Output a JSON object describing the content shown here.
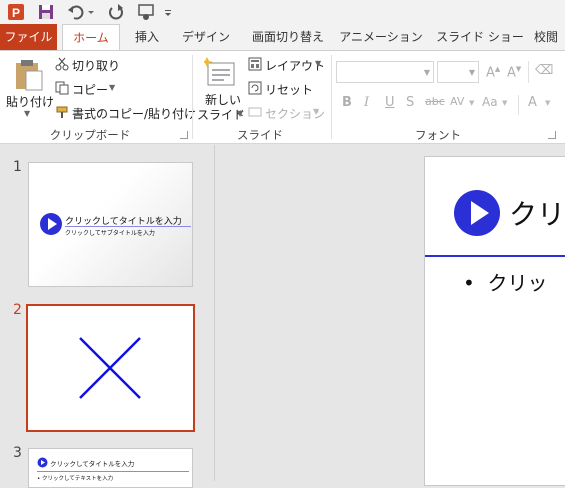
{
  "qat": {
    "icons": [
      "powerpoint-app-icon",
      "save-icon",
      "undo-icon",
      "redo-icon",
      "start-from-beginning-icon",
      "customize-qat-icon"
    ]
  },
  "tabs": [
    {
      "label": "ファイル"
    },
    {
      "label": "ホーム"
    },
    {
      "label": "挿入"
    },
    {
      "label": "デザイン"
    },
    {
      "label": "画面切り替え"
    },
    {
      "label": "アニメーション"
    },
    {
      "label": "スライド ショー"
    },
    {
      "label": "校閲"
    }
  ],
  "clipboard": {
    "paste_label": "貼り付け",
    "cut_label": "切り取り",
    "copy_label": "コピー",
    "format_painter_label": "書式のコピー/貼り付け",
    "group_label": "クリップボード"
  },
  "slides_group": {
    "new_slide_line1": "新しい",
    "new_slide_line2": "スライド",
    "layout_label": "レイアウト",
    "reset_label": "リセット",
    "section_label": "セクション",
    "group_label": "スライド"
  },
  "font_group": {
    "group_label": "フォント",
    "font_name": "",
    "font_size": ""
  },
  "thumbnails": [
    {
      "number": "1",
      "title": "クリックしてタイトルを入力",
      "subtitle": "クリックしてサブタイトルを入力"
    },
    {
      "number": "2"
    },
    {
      "number": "3",
      "title": "クリックしてタイトルを入力",
      "bullet": "クリックしてテキストを入力"
    }
  ],
  "main_slide": {
    "title": "クリッ",
    "bullet": "クリッ"
  },
  "colors": {
    "accent": "#c43e1c",
    "slide_blue": "#2b2fd6",
    "x_blue": "#1010e6"
  }
}
